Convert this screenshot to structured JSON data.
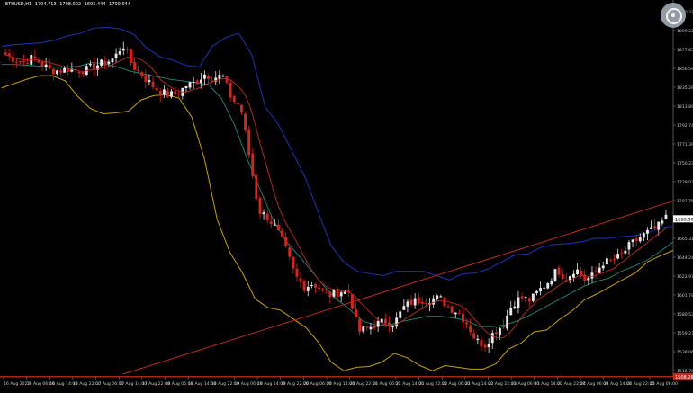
{
  "header": {
    "symbol": "ETHUSD,H1",
    "ohlc": [
      "1704.713",
      "1708.002",
      "1695.444",
      "1700.044"
    ]
  },
  "corner_widget": {
    "icon": "crosshair-icon"
  },
  "colors": {
    "background": "#000000",
    "bull_candle": "#e8e8e8",
    "bear_candle": "#e0201a",
    "upper_band": "#1a2fa8",
    "lower_band": "#c8a000",
    "ma_teal": "#1b8a7a",
    "ma_red": "#c0281e",
    "trendline": "#c0281e",
    "price_line": "#8c8c8c",
    "support_line": "#c0281e",
    "axis": "#8c8c8c",
    "label": "#c8c8c8"
  },
  "chart_data": {
    "type": "candlestick",
    "title": "",
    "price_labels": [
      "1920.370",
      "1899.224",
      "1877.850",
      "1856.596",
      "1835.286",
      "1813.890",
      "1792.742",
      "1771.390",
      "1750.233",
      "1729.031",
      "1707.758",
      "1686.513",
      "1665.314",
      "1644.248",
      "1622.973",
      "1601.781",
      "1580.538",
      "1559.270",
      "1538.068",
      "1516.784"
    ],
    "ylim": [
      1508.0,
      1931.0
    ],
    "current_price": "1690.590",
    "current_price_value": 1690.59,
    "support_price": "1508.262",
    "support_value": 1508.26,
    "time_labels": [
      "16 Aug 2022",
      "16 Aug 06:00",
      "16 Aug 14:00",
      "16 Aug 22:00",
      "17 Aug 06:00",
      "17 Aug 14:00",
      "17 Aug 22:00",
      "18 Aug 06:00",
      "18 Aug 14:00",
      "18 Aug 22:00",
      "19 Aug 06:00",
      "19 Aug 14:00",
      "19 Aug 22:00",
      "20 Aug 06:00",
      "20 Aug 14:00",
      "20 Aug 22:00",
      "21 Aug 06:00",
      "21 Aug 14:00",
      "21 Aug 22:00",
      "22 Aug 06:00",
      "22 Aug 14:00",
      "22 Aug 22:00",
      "23 Aug 06:00",
      "23 Aug 14:00",
      "23 Aug 22:00",
      "24 Aug 06:00",
      "24 Aug 14:00",
      "24 Aug 22:00",
      "25 Aug 06:00"
    ],
    "close_anchors": [
      1880,
      1875,
      1872,
      1877,
      1870,
      1862,
      1862,
      1864,
      1862,
      1863,
      1868,
      1871,
      1876,
      1892,
      1868,
      1858,
      1847,
      1838,
      1834,
      1835,
      1845,
      1848,
      1858,
      1854,
      1856,
      1829,
      1820,
      1760,
      1700,
      1692,
      1678,
      1655,
      1625,
      1612,
      1616,
      1608,
      1602,
      1607,
      1606,
      1560,
      1564,
      1569,
      1572,
      1570,
      1588,
      1595,
      1597,
      1598,
      1599,
      1588,
      1583,
      1570,
      1550,
      1545,
      1560,
      1568,
      1592,
      1600,
      1596,
      1608,
      1618,
      1632,
      1621,
      1634,
      1620,
      1625,
      1640,
      1642,
      1648,
      1660,
      1668,
      1675,
      1680,
      1692
    ],
    "upper_band": [
      1890,
      1892,
      1893,
      1894,
      1897,
      1902,
      1905,
      1911,
      1912,
      1910,
      1904,
      1888,
      1878,
      1874,
      1868,
      1866,
      1890,
      1900,
      1905,
      1880,
      1820,
      1800,
      1770,
      1740,
      1700,
      1660,
      1640,
      1630,
      1627,
      1625,
      1630,
      1630,
      1630,
      1625,
      1620,
      1627,
      1628,
      1633,
      1641,
      1649,
      1650,
      1658,
      1661,
      1662,
      1664,
      1668,
      1668,
      1670,
      1671,
      1674,
      1680,
      1682
    ],
    "lower_band": [
      1842,
      1847,
      1852,
      1856,
      1856,
      1850,
      1832,
      1818,
      1812,
      1813,
      1815,
      1828,
      1833,
      1834,
      1830,
      1808,
      1760,
      1690,
      1652,
      1628,
      1598,
      1588,
      1585,
      1575,
      1565,
      1548,
      1525,
      1515,
      1519,
      1520,
      1525,
      1535,
      1530,
      1521,
      1515,
      1521,
      1519,
      1517,
      1517,
      1523,
      1540,
      1547,
      1560,
      1562,
      1574,
      1584,
      1597,
      1604,
      1612,
      1620,
      1628,
      1641,
      1648,
      1654
    ],
    "ma_teal": [
      1869,
      1869,
      1868,
      1867,
      1866,
      1866,
      1867,
      1871,
      1870,
      1866,
      1861,
      1858,
      1855,
      1852,
      1850,
      1848,
      1846,
      1830,
      1800,
      1760,
      1725,
      1690,
      1665,
      1648,
      1630,
      1612,
      1597,
      1585,
      1572,
      1568,
      1568,
      1572,
      1575,
      1578,
      1578,
      1576,
      1573,
      1566,
      1566,
      1568,
      1573,
      1580,
      1588,
      1596,
      1604,
      1612,
      1618,
      1622,
      1630,
      1636,
      1643,
      1653,
      1664
    ],
    "trendline": [
      [
        18,
        1511
      ],
      [
        73,
        1705
      ]
    ],
    "trendline_units": "x in candle-index fraction percent, y in price"
  }
}
